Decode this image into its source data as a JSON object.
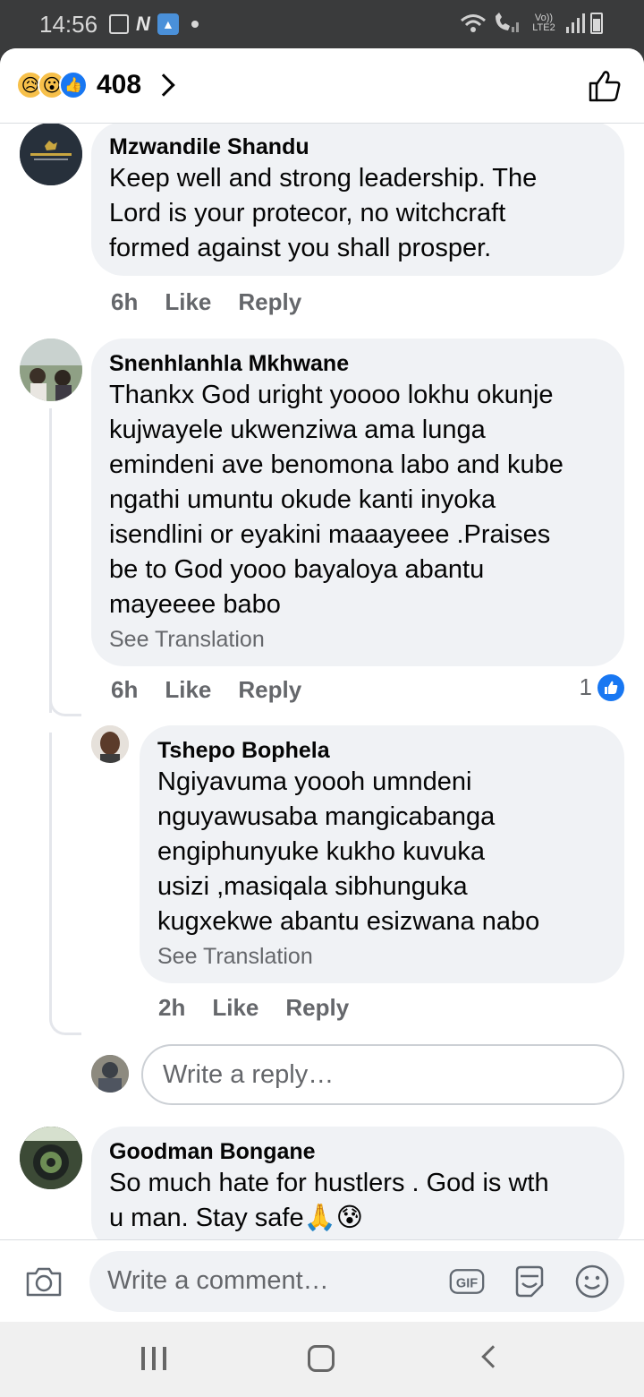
{
  "status_bar": {
    "time": "14:56",
    "network_label": "Vo)) LTE2"
  },
  "header": {
    "reaction_icons": [
      "sad-emoji",
      "wow-emoji",
      "like-reaction"
    ],
    "reaction_count": "408"
  },
  "comments": [
    {
      "author": "Mzwandile Shandu",
      "text_lines": [
        "Keep well and strong leadership. The",
        "Lord is your protecor, no witchcraft",
        "formed against you shall prosper."
      ],
      "time": "6h",
      "like_label": "Like",
      "reply_label": "Reply"
    },
    {
      "author": "Snenhlanhla Mkhwane",
      "text_lines": [
        "Thankx God uright yoooo lokhu okunje",
        "kujwayele ukwenziwa ama lunga",
        "emindeni ave benomona labo and kube",
        "ngathi umuntu okude kanti inyoka",
        "isendlini or eyakini maaayeee .Praises",
        "be to God yooo bayaloya abantu",
        "mayeeee babo"
      ],
      "see_translation": "See Translation",
      "time": "6h",
      "like_label": "Like",
      "reply_label": "Reply",
      "like_count": "1",
      "replies": [
        {
          "author": "Tshepo Bophela",
          "text_lines": [
            "Ngiyavuma yoooh umndeni",
            "nguyawusaba mangicabanga",
            "engiphunyuke kukho kuvuka",
            "usizi ,masiqala sibhunguka",
            "kugxekwe abantu esizwana nabo"
          ],
          "see_translation": "See Translation",
          "time": "2h",
          "like_label": "Like",
          "reply_label": "Reply"
        }
      ],
      "reply_placeholder": "Write a reply…"
    },
    {
      "author": "Goodman Bongane",
      "text_lines": [
        "So much hate for hustlers .  God is wth",
        "u man. Stay safe🙏😰"
      ]
    }
  ],
  "composer": {
    "placeholder": "Write a comment…",
    "icons": [
      "camera-icon",
      "gif-icon",
      "sticker-icon",
      "emoji-icon"
    ]
  },
  "nav": {
    "icons": [
      "recent-apps-icon",
      "home-icon",
      "back-icon"
    ]
  },
  "colors": {
    "bubble": "#f0f2f5",
    "meta_text": "#65676b",
    "like_blue": "#1877f2",
    "status_bar": "#3a3b3c"
  }
}
